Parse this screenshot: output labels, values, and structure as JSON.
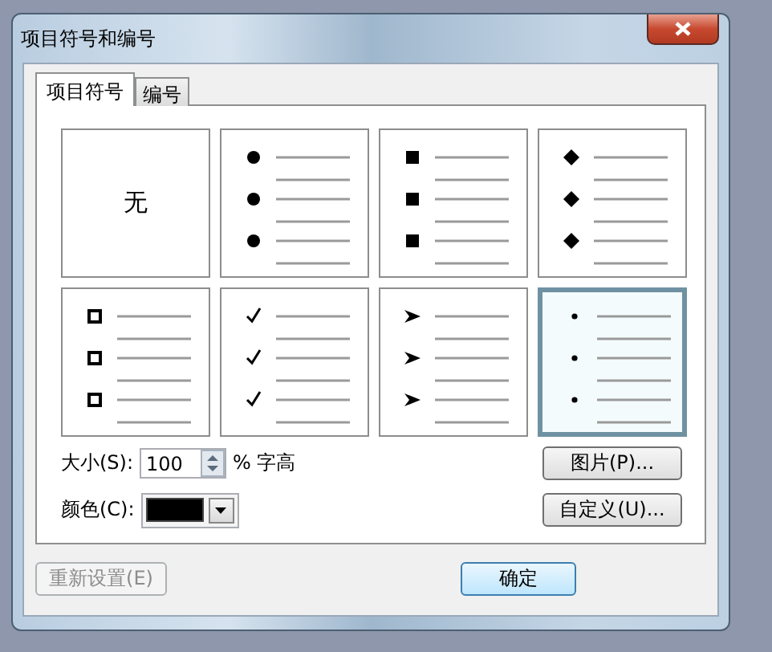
{
  "window": {
    "title": "项目符号和编号"
  },
  "tabs": [
    {
      "label": "项目符号",
      "selected": true
    },
    {
      "label": "编号",
      "selected": false
    }
  ],
  "bullet_styles": [
    {
      "kind": "none",
      "label": "无",
      "selected": false
    },
    {
      "kind": "dot",
      "selected": false
    },
    {
      "kind": "square",
      "selected": false
    },
    {
      "kind": "diamond",
      "selected": false
    },
    {
      "kind": "hollow-square",
      "selected": false
    },
    {
      "kind": "check",
      "selected": false
    },
    {
      "kind": "arrowhead",
      "selected": false
    },
    {
      "kind": "small-dot",
      "selected": true
    }
  ],
  "size": {
    "label": "大小(S):",
    "value": "100",
    "unit": "% 字高"
  },
  "color": {
    "label": "颜色(C):",
    "color": "#000000"
  },
  "side_buttons": [
    {
      "label": "图片(P)...",
      "disabled": false
    },
    {
      "label": "自定义(U)...",
      "disabled": false
    }
  ],
  "footer_buttons": [
    {
      "label": "重新设置(E)",
      "disabled": true,
      "default": false
    },
    {
      "label": "确定",
      "disabled": false,
      "default": true
    }
  ]
}
